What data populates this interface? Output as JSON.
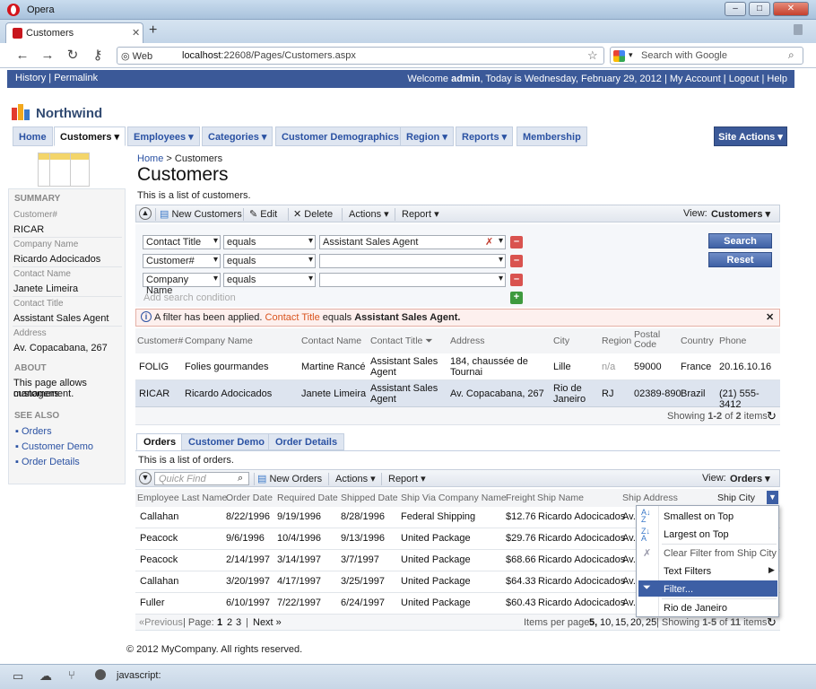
{
  "browser": {
    "app_title": "Opera",
    "tab_title": "Customers",
    "web_label": "Web",
    "url_host": "localhost",
    "url_path": ":22608/Pages/Customers.aspx",
    "search_placeholder": "Search with Google",
    "status_text": "javascript:"
  },
  "sitebar": {
    "history": "History",
    "permalink": "Permalink",
    "welcome_prefix": "Welcome ",
    "user": "admin",
    "date_text": ", Today is Wednesday, February 29, 2012",
    "my_account": "My Account",
    "logout": "Logout",
    "help": "Help"
  },
  "brand": {
    "name": "Northwind"
  },
  "menu": [
    "Home",
    "Customers",
    "Employees",
    "Categories",
    "Customer Demographics",
    "Region",
    "Reports",
    "Membership"
  ],
  "site_actions": "Site Actions",
  "sidebar": {
    "summary": "SUMMARY",
    "fields": [
      {
        "label": "Customer#",
        "value": "RICAR"
      },
      {
        "label": "Company Name",
        "value": "Ricardo Adocicados"
      },
      {
        "label": "Contact Name",
        "value": "Janete Limeira"
      },
      {
        "label": "Contact Title",
        "value": "Assistant Sales Agent"
      },
      {
        "label": "Address",
        "value": "Av. Copacabana, 267"
      }
    ],
    "about": "ABOUT",
    "about_text_1": "This page allows customers",
    "about_text_2": "management.",
    "see_also": "SEE ALSO",
    "links": [
      "Orders",
      "Customer Demo",
      "Order Details"
    ]
  },
  "page": {
    "breadcrumb_home": "Home",
    "breadcrumb_current": "Customers",
    "title": "Customers",
    "description": "This is a list of customers."
  },
  "customers_toolbar": {
    "new": "New Customers",
    "edit": "Edit",
    "delete": "Delete",
    "actions": "Actions",
    "report": "Report",
    "view_label": "View:",
    "view_value": "Customers"
  },
  "filters": [
    {
      "field": "Contact Title",
      "op": "equals",
      "value": "Assistant Sales Agent"
    },
    {
      "field": "Customer#",
      "op": "equals",
      "value": ""
    },
    {
      "field": "Company Name",
      "op": "equals",
      "value": ""
    }
  ],
  "add_condition": "Add search condition",
  "search_btn": "Search",
  "reset_btn": "Reset",
  "alert": {
    "prefix": "A filter has been applied.",
    "field": "Contact Title",
    "op": "equals",
    "value": "Assistant Sales Agent."
  },
  "customer_columns": [
    "Customer#",
    "Company Name",
    "Contact Name",
    "Contact Title",
    "Address",
    "City",
    "Region",
    "Postal Code",
    "Country",
    "Phone"
  ],
  "customer_rows": [
    {
      "id": "FOLIG",
      "company": "Folies gourmandes",
      "contact": "Martine Rancé",
      "title1": "Assistant Sales",
      "title2": "Agent",
      "addr1": "184, chaussée de",
      "addr2": "Tournai",
      "city1": "Lille",
      "city2": "",
      "region": "n/a",
      "postal": "59000",
      "country": "France",
      "phone": "20.16.10.16"
    },
    {
      "id": "RICAR",
      "company": "Ricardo Adocicados",
      "contact": "Janete Limeira",
      "title1": "Assistant Sales",
      "title2": "Agent",
      "addr1": "Av. Copacabana, 267",
      "addr2": "",
      "city1": "Rio de",
      "city2": "Janeiro",
      "region": "RJ",
      "postal": "02389-890",
      "country": "Brazil",
      "phone": "(21) 555-3412"
    }
  ],
  "customers_paging": {
    "showing": "Showing ",
    "range": "1-2",
    "of": " of ",
    "total": "2",
    "items": " items"
  },
  "child_tabs": [
    "Orders",
    "Customer Demo",
    "Order Details"
  ],
  "orders": {
    "description": "This is a list of orders.",
    "quick_find": "Quick Find",
    "new": "New Orders",
    "actions": "Actions",
    "report": "Report",
    "view_label": "View:",
    "view_value": "Orders",
    "columns": [
      "Employee Last Name",
      "Order Date",
      "Required Date",
      "Shipped Date",
      "Ship Via Company Name",
      "Freight",
      "Ship Name",
      "Ship Address",
      "Ship City"
    ],
    "rows": [
      {
        "emp": "Callahan",
        "od": "8/22/1996",
        "rd": "9/19/1996",
        "sd": "8/28/1996",
        "via": "Federal Shipping",
        "fr": "$12.76",
        "name": "Ricardo Adocicados",
        "addr": "Av."
      },
      {
        "emp": "Peacock",
        "od": "9/6/1996",
        "rd": "10/4/1996",
        "sd": "9/13/1996",
        "via": "United Package",
        "fr": "$29.76",
        "name": "Ricardo Adocicados",
        "addr": "Av."
      },
      {
        "emp": "Peacock",
        "od": "2/14/1997",
        "rd": "3/14/1997",
        "sd": "3/7/1997",
        "via": "United Package",
        "fr": "$68.66",
        "name": "Ricardo Adocicados",
        "addr": "Av."
      },
      {
        "emp": "Callahan",
        "od": "3/20/1997",
        "rd": "4/17/1997",
        "sd": "3/25/1997",
        "via": "United Package",
        "fr": "$64.33",
        "name": "Ricardo Adocicados",
        "addr": "Av."
      },
      {
        "emp": "Fuller",
        "od": "6/10/1997",
        "rd": "7/22/1997",
        "sd": "6/24/1997",
        "via": "United Package",
        "fr": "$60.43",
        "name": "Ricardo Adocicados",
        "addr": "Av."
      }
    ],
    "pager": {
      "prev": "«Previous",
      "page_label": "Page:",
      "pages": [
        "1",
        "2",
        "3"
      ],
      "next": "Next »",
      "per_page": "Items per page:",
      "sizes": [
        "5,",
        "10,",
        "15,",
        "20,",
        "25"
      ],
      "showing": "Showing ",
      "range": "1-5",
      "of": " of ",
      "total": "11",
      "items": " items"
    }
  },
  "context_menu": [
    "Smallest on Top",
    "Largest on Top",
    "Clear Filter from Ship City",
    "Text Filters",
    "Filter...",
    "Rio de Janeiro"
  ],
  "footer": "© 2012 MyCompany. All rights reserved."
}
